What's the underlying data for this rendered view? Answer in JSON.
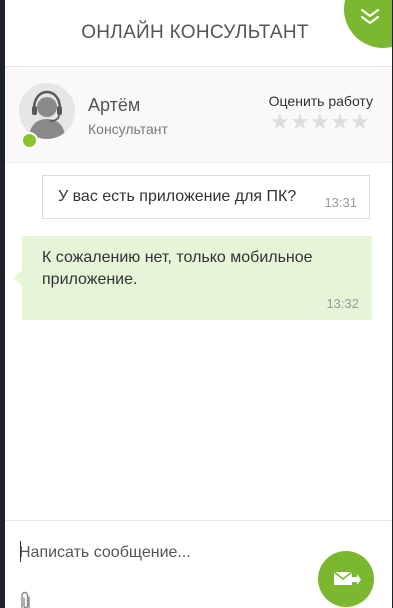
{
  "header": {
    "title": "ОНЛАЙН КОНСУЛЬТАНТ",
    "collapse_icon": "double-chevron-down-icon",
    "accent_color": "#7cb82f"
  },
  "operator": {
    "name": "Артём",
    "role": "Консультант",
    "status": "online",
    "status_color": "#88c42c",
    "avatar_icon": "support-agent-headset-icon",
    "rate_label": "Оценить работу",
    "rating": 0,
    "max_rating": 5,
    "star_symbol": "★"
  },
  "messages": [
    {
      "direction": "outgoing",
      "text": "У вас есть приложение для ПК?",
      "time": "13:31"
    },
    {
      "direction": "incoming",
      "text": "К сожалению нет, только мобильное приложение.",
      "time": "13:32",
      "bubble_color": "#e6f4d8"
    }
  ],
  "composer": {
    "placeholder": "Написать сообщение...",
    "value": "",
    "attach_icon": "paperclip-icon",
    "send_icon": "send-mail-icon"
  }
}
